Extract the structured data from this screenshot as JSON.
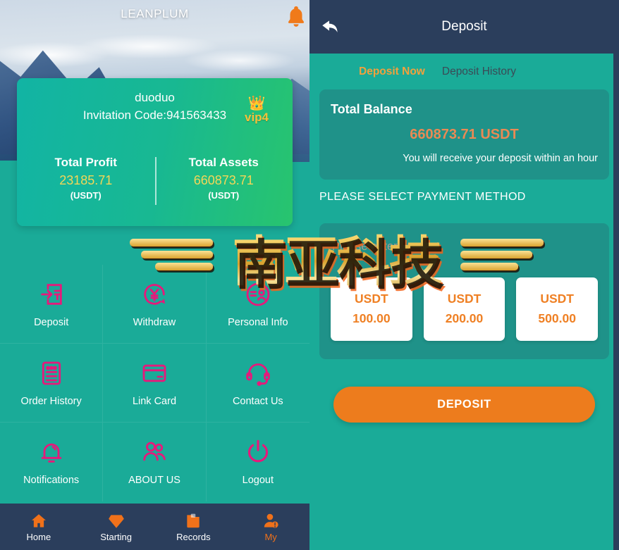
{
  "left": {
    "brand": "LEANPLUM",
    "bell_icon": "bell-icon",
    "profile": {
      "name": "duoduo",
      "invitation": "Invitation Code:941563433",
      "vip_label": "vip4",
      "crown_icon": "crown-icon",
      "stats": [
        {
          "title": "Total Profit",
          "value": "23185.71",
          "unit": "(USDT)"
        },
        {
          "title": "Total Assets",
          "value": "660873.71",
          "unit": "(USDT)"
        }
      ]
    },
    "menu": [
      {
        "label": "Deposit",
        "icon": "deposit-arrow-icon"
      },
      {
        "label": "Withdraw",
        "icon": "withdraw-circle-icon"
      },
      {
        "label": "Personal Info",
        "icon": "person-info-icon"
      },
      {
        "label": "Order History",
        "icon": "order-list-icon"
      },
      {
        "label": "Link Card",
        "icon": "credit-card-icon"
      },
      {
        "label": "Contact Us",
        "icon": "headset-icon"
      },
      {
        "label": "Notifications",
        "icon": "bell-icon"
      },
      {
        "label": "ABOUT US",
        "icon": "users-icon"
      },
      {
        "label": "Logout",
        "icon": "power-icon"
      }
    ],
    "bottom_nav": [
      {
        "label": "Home",
        "icon": "home-icon",
        "active": false
      },
      {
        "label": "Starting",
        "icon": "diamond-icon",
        "active": false
      },
      {
        "label": "Records",
        "icon": "records-icon",
        "active": false
      },
      {
        "label": "My",
        "icon": "profile-icon",
        "active": true
      }
    ]
  },
  "right": {
    "topbar": {
      "title": "Deposit",
      "back_icon": "back-arrow-icon"
    },
    "tabs": [
      {
        "label": "Deposit Now",
        "active": true
      },
      {
        "label": "Deposit History",
        "active": false
      }
    ],
    "balance": {
      "title": "Total Balance",
      "value": "660873.71 USDT",
      "note": "You will receive your deposit within an hour"
    },
    "payment_heading": "PLEASE SELECT PAYMENT METHOD",
    "amount_input": {
      "placeholder": "Please enter amount",
      "value": ""
    },
    "amount_options": [
      {
        "currency": "USDT",
        "amount": "100.00"
      },
      {
        "currency": "USDT",
        "amount": "200.00"
      },
      {
        "currency": "USDT",
        "amount": "500.00"
      }
    ],
    "deposit_button": "DEPOSIT"
  },
  "watermark": {
    "text": "南亚科技"
  },
  "colors": {
    "teal_bg": "#1aab98",
    "card_teal": "#1f9289",
    "navy": "#2b3e5c",
    "orange": "#ed7c1d",
    "pink": "#e6197b",
    "gold": "#f4c13a"
  }
}
